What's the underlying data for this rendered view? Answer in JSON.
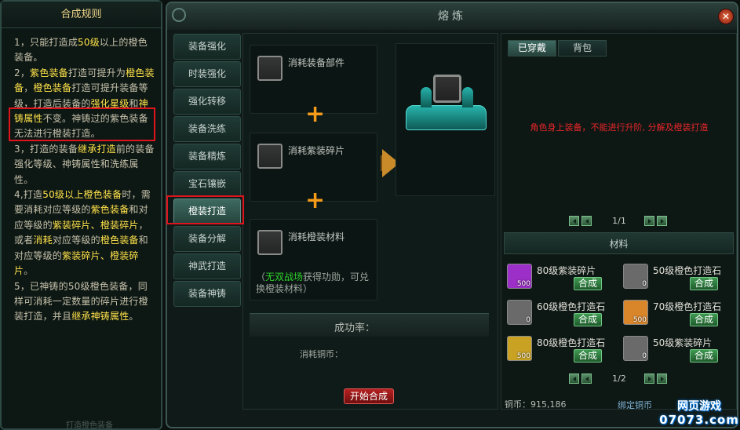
{
  "rules": {
    "title": "合成规则",
    "p1": "1，只能打造成",
    "p1b": "50级",
    "p1c": "以上的橙色装备。",
    "p2a": "2，",
    "p2b": "紫色装备",
    "p2c": "打造可提升为",
    "p2d": "橙色装备",
    "p2e": "，",
    "p2f": "橙色装备",
    "p2g": "打造可提升装备等级，打造后装备的",
    "p2h": "强化星级",
    "p2i": "和",
    "p2j": "神铸属性",
    "p2k": "不变。神铸过的紫色装备无法进行橙装打造。",
    "p3a": "3，打造的装备",
    "p3b": "继承打造",
    "p3c": "前的装备强化等级、神铸属性和洗练属性。",
    "p4a": "4,打造",
    "p4b": "50级以上橙色装备",
    "p4c": "时，需要消耗对应等级的",
    "p4d": "紫色装备",
    "p4e": "和对应等级的",
    "p4f": "紫装碎片、橙装碎片",
    "p4g": "，或者",
    "p4h": "消耗",
    "p4i": "对应等级的",
    "p4j": "橙色装备",
    "p4k": "和对应等级的",
    "p4l": "紫装碎片、橙装碎片",
    "p4m": "。",
    "p5a": "5，已神铸的50级橙色装备，同样可消耗一定数量的碎片进行橙装打造，并且",
    "p5b": "继承神铸属性",
    "p5c": "。",
    "footer": "打造橙色装备"
  },
  "window": {
    "title": "熔炼",
    "close": "✕"
  },
  "tabs": [
    "装备强化",
    "时装强化",
    "强化转移",
    "装备洗练",
    "装备精炼",
    "宝石镶嵌",
    "橙装打造",
    "装备分解",
    "神武打造",
    "装备神铸"
  ],
  "active_tab": "橙装打造",
  "center": {
    "slot1": "消耗装备部件",
    "slot2": "消耗紫装碎片",
    "slot3": "消耗橙装材料",
    "plus": "+",
    "hint_green": "无双战场",
    "hint_rest": "获得功勋，可兑换橙装材料）",
    "hint_open": "（",
    "rate_label": "成功率：",
    "cost_label": "消耗铜币：",
    "start_button": "开始合成"
  },
  "right": {
    "tab_worn": "已穿戴",
    "tab_bag": "背包",
    "empty_msg": "角色身上装备，不能进行升阶, 分解及橙装打造",
    "page_top": "1/1",
    "materials_header": "材料",
    "materials": [
      {
        "name": "80级紫装碎片",
        "qty": "500",
        "button": "合成",
        "color": "#9c2fc7"
      },
      {
        "name": "50级橙色打造石",
        "qty": "0",
        "button": "合成",
        "color": "#6a6a6a"
      },
      {
        "name": "60级橙色打造石",
        "qty": "0",
        "button": "合成",
        "color": "#6a6a6a"
      },
      {
        "name": "70级橙色打造石",
        "qty": "500",
        "button": "合成",
        "color": "#d9862a"
      },
      {
        "name": "80级橙色打造石",
        "qty": "500",
        "button": "合成",
        "color": "#c9a224"
      },
      {
        "name": "50级紫装碎片",
        "qty": "0",
        "button": "合成",
        "color": "#6a6a6a"
      }
    ],
    "page_bottom": "1/2",
    "coins": "铜币：915,186",
    "bind_coins": "绑定铜币"
  },
  "watermark": {
    "line1": "网页游戏",
    "line2": "07073.com"
  }
}
